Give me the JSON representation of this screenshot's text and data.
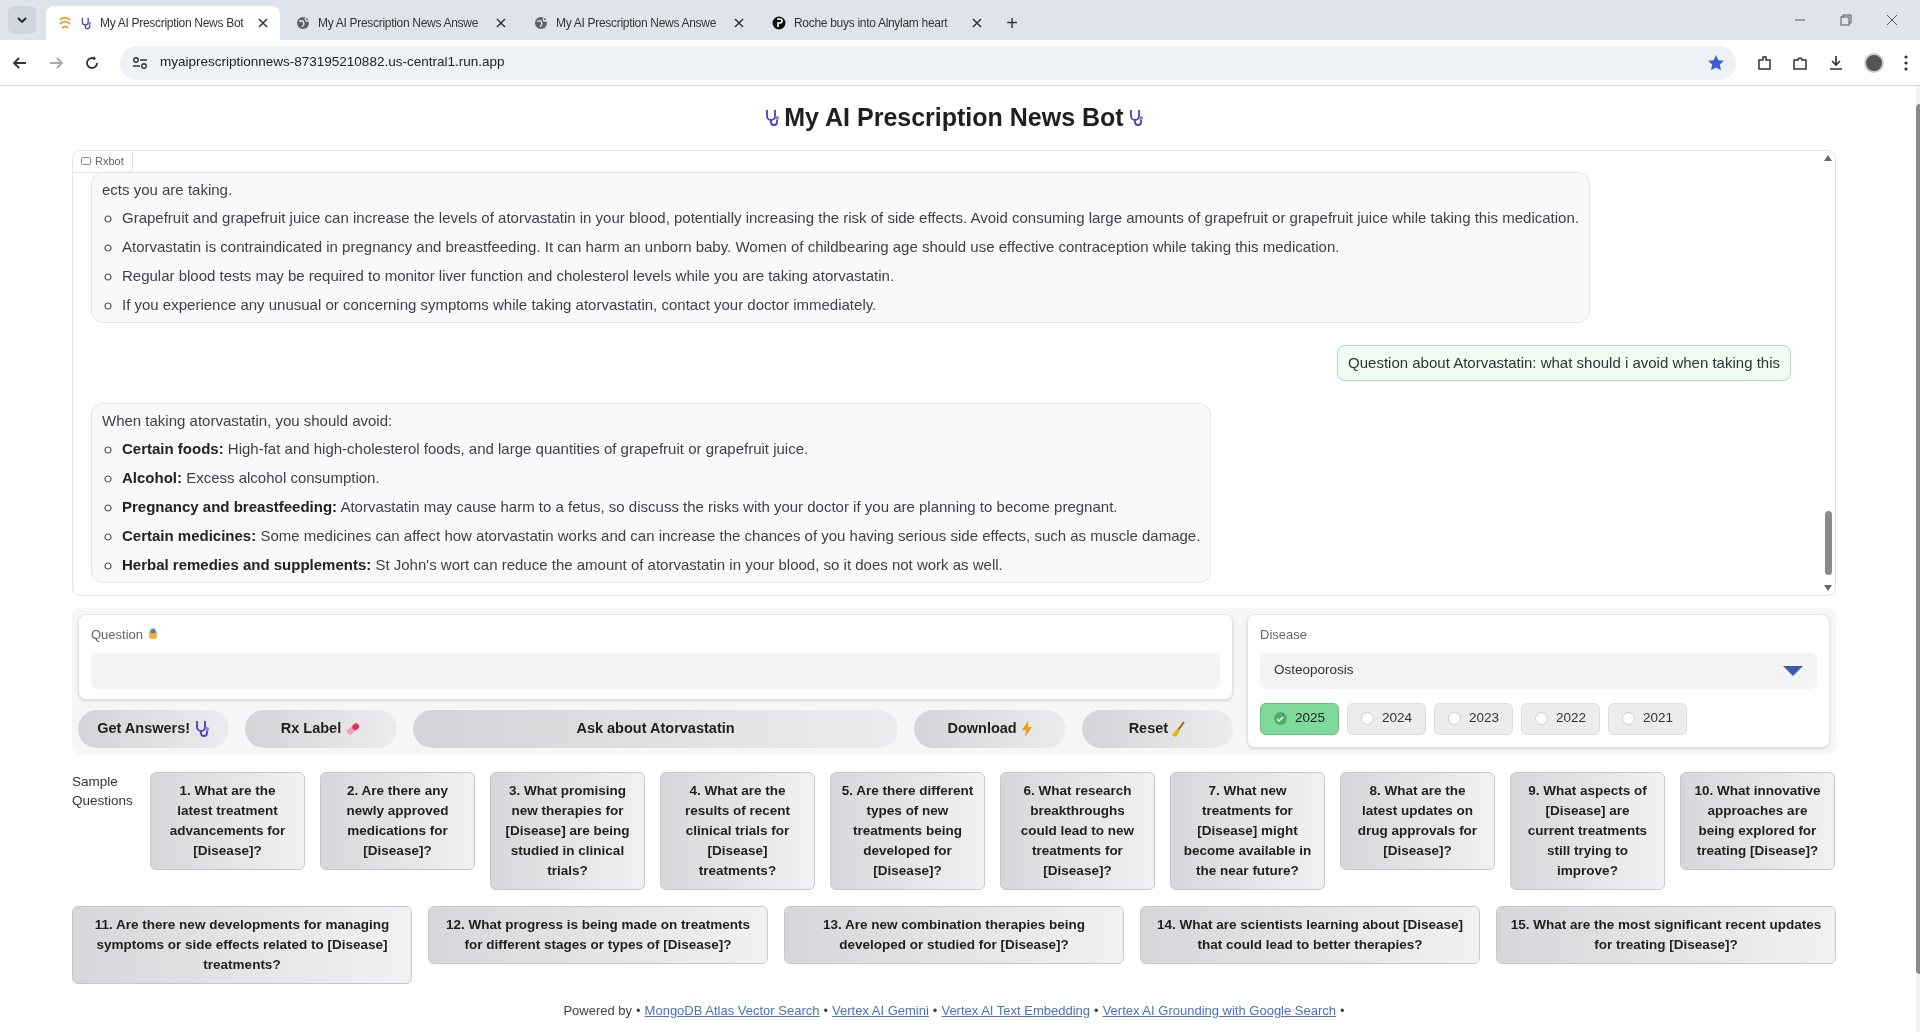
{
  "browser": {
    "tabs": [
      {
        "title": "My AI Prescription News Bot",
        "selected": true
      },
      {
        "title": "My AI Prescription News Answe",
        "selected": false
      },
      {
        "title": "My AI Prescription News Answe",
        "selected": false
      },
      {
        "title": "Roche buys into Alnylam heart",
        "selected": false
      }
    ],
    "new_tab": "+",
    "url": "myaiprescriptionnews-873195210882.us-central1.run.app"
  },
  "title": "My AI Prescription News Bot",
  "chat": {
    "label": "Rxbot",
    "messages": [
      {
        "kind": "bot",
        "intro": "ects you are taking.",
        "items": [
          {
            "text": "Grapefruit and grapefruit juice can increase the levels of atorvastatin in your blood, potentially increasing the risk of side effects. Avoid consuming large amounts of grapefruit or grapefruit juice while taking this medication."
          },
          {
            "text": "Atorvastatin is contraindicated in pregnancy and breastfeeding. It can harm an unborn baby. Women of childbearing age should use effective contraception while taking this medication."
          },
          {
            "text": "Regular blood tests may be required to monitor liver function and cholesterol levels while you are taking atorvastatin."
          },
          {
            "text": "If you experience any unusual or concerning symptoms while taking atorvastatin, contact your doctor immediately."
          }
        ]
      },
      {
        "kind": "user",
        "text": "Question about Atorvastatin: what should i avoid when taking this"
      },
      {
        "kind": "bot",
        "intro": "When taking atorvastatin, you should avoid:",
        "items": [
          {
            "label": "Certain foods:",
            "text": "High-fat and high-cholesterol foods, and large quantities of grapefruit or grapefruit juice."
          },
          {
            "label": "Alcohol:",
            "text": "Excess alcohol consumption."
          },
          {
            "label": "Pregnancy and breastfeeding:",
            "text": "Atorvastatin may cause harm to a fetus, so discuss the risks with your doctor if you are planning to become pregnant."
          },
          {
            "label": "Certain medicines:",
            "text": "Some medicines can affect how atorvastatin works and can increase the chances of you having serious side effects, such as muscle damage."
          },
          {
            "label": "Herbal remedies and supplements:",
            "text": "St John's wort can reduce the amount of atorvastatin in your blood, so it does not work as well."
          }
        ]
      }
    ]
  },
  "question": {
    "label": "Question"
  },
  "disease": {
    "label": "Disease",
    "value": "Osteoporosis",
    "years": [
      {
        "label": "2025",
        "selected": true
      },
      {
        "label": "2024",
        "selected": false
      },
      {
        "label": "2023",
        "selected": false
      },
      {
        "label": "2022",
        "selected": false
      },
      {
        "label": "2021",
        "selected": false
      }
    ]
  },
  "buttons": [
    "Get Answers!",
    "Rx Label",
    "Ask about Atorvastatin",
    "Download",
    "Reset"
  ],
  "samples": {
    "label": "Sample Questions",
    "items": [
      "1. What are the latest treatment advancements for [Disease]?",
      "2. Are there any newly approved medications for [Disease]?",
      "3. What promising new therapies for [Disease] are being studied in clinical trials?",
      "4. What are the results of recent clinical trials for [Disease] treatments?",
      "5. Are there different types of new treatments being developed for [Disease]?",
      "6. What research breakthroughs could lead to new treatments for [Disease]?",
      "7. What new treatments for [Disease] might become available in the near future?",
      "8. What are the latest updates on drug approvals for [Disease]?",
      "9. What aspects of [Disease] are current treatments still trying to improve?",
      "10. What innovative approaches are being explored for treating [Disease]?",
      "11. Are there new developments for managing symptoms or side effects related to [Disease] treatments?",
      "12. What progress is being made on treatments for different stages or types of [Disease]?",
      "13. Are new combination therapies being developed or studied for [Disease]?",
      "14. What are scientists learning about [Disease] that could lead to better therapies?",
      "15. What are the most significant recent updates for treating [Disease]?"
    ]
  },
  "footer": {
    "prefix": "Powered by",
    "separator": "•",
    "links": [
      "MongoDB Atlas Vector Search",
      "Vertex AI Gemini",
      "Vertex AI Text Embedding",
      "Vertex AI Grounding with Google Search"
    ]
  }
}
